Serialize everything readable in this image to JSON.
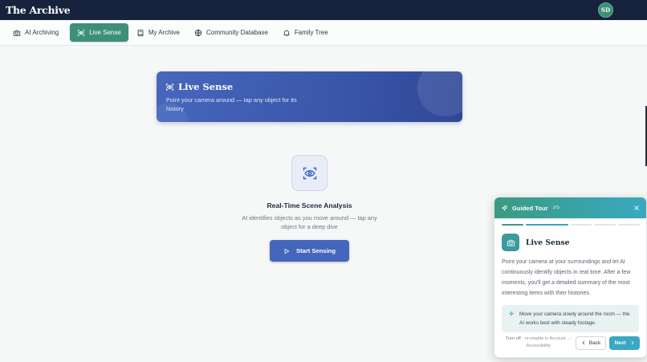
{
  "app": {
    "brand": "The Archive",
    "avatar_initials": "SD"
  },
  "nav": {
    "items": [
      {
        "label": "AI Archiving",
        "icon": "camera-icon",
        "active": false
      },
      {
        "label": "Live Sense",
        "icon": "scan-eye-icon",
        "active": true
      },
      {
        "label": "My Archive",
        "icon": "book-icon",
        "active": false
      },
      {
        "label": "Community Database",
        "icon": "globe-icon",
        "active": false
      },
      {
        "label": "Family Tree",
        "icon": "bell-icon",
        "active": false
      }
    ]
  },
  "hero": {
    "title": "Live Sense",
    "subtitle": "Point your camera around — tap any object for its history"
  },
  "scene": {
    "title": "Real-Time Scene Analysis",
    "description": "AI identifies objects as you move around — tap any object for a deep dive",
    "start_label": "Start Sensing"
  },
  "tour": {
    "header": "Guided Tour",
    "step": "2/5",
    "progress": {
      "current": 2,
      "total": 5
    },
    "title": "Live Sense",
    "body": "Point your camera at your surroundings and let AI continuously identify objects in real time. After a few moments, you'll get a detailed summary of the most interesting items with their histories.",
    "tip": "Move your camera slowly around the room — the AI works best with steady footage.",
    "turn_off": "Turn off",
    "turn_off_hint": "· re-enable in Account → Accessibility",
    "back_label": "Back",
    "next_label": "Next"
  },
  "colors": {
    "accent_green": "#3d8f78",
    "accent_blue": "#4566bd",
    "tour_teal": "#39a9c0",
    "topbar": "#17233d"
  }
}
